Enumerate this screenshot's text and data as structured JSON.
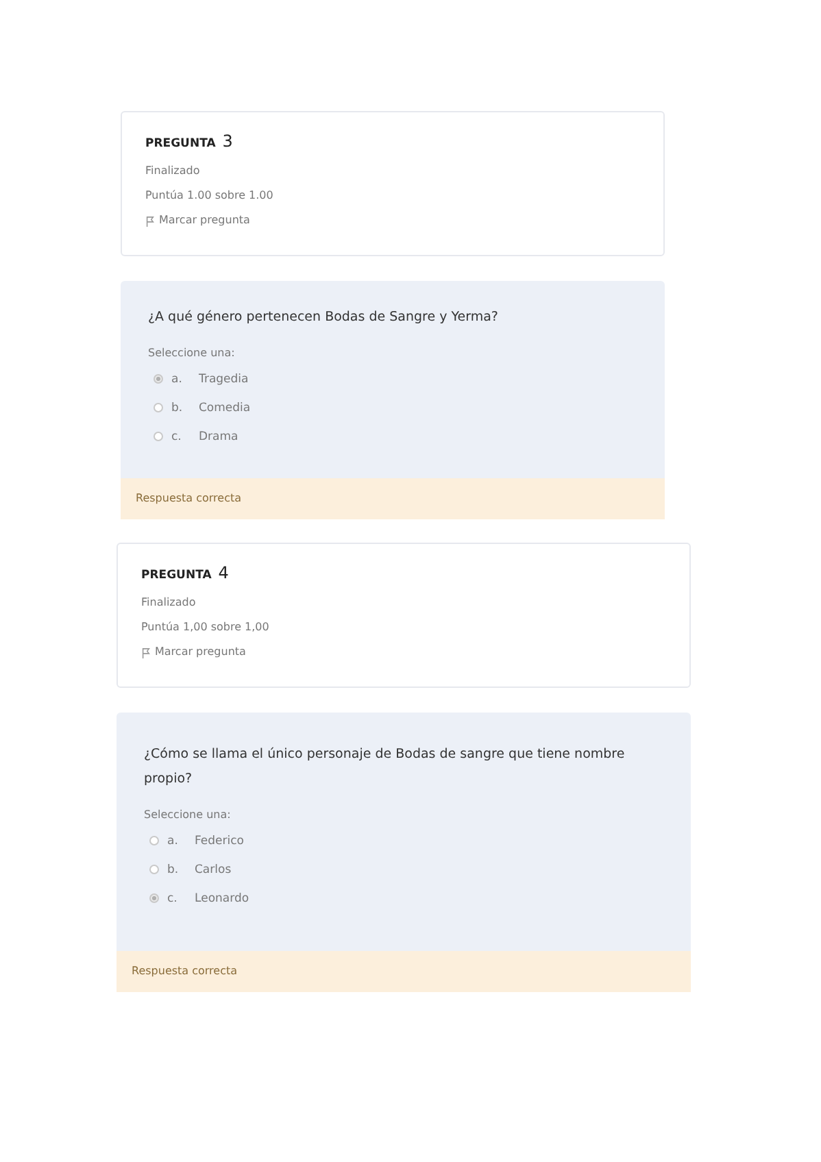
{
  "questions": [
    {
      "label": "PREGUNTA",
      "number": "3",
      "status": "Finalizado",
      "score": "Puntúa 1.00 sobre 1.00",
      "flag": "Marcar pregunta",
      "text": "¿A qué género pertenecen Bodas de Sangre y Yerma?",
      "prompt": "Seleccione una:",
      "options": [
        {
          "letter": "a.",
          "text": "Tragedia",
          "selected": true
        },
        {
          "letter": "b.",
          "text": "Comedia",
          "selected": false
        },
        {
          "letter": "c.",
          "text": "Drama",
          "selected": false
        }
      ],
      "feedback": "Respuesta correcta"
    },
    {
      "label": "PREGUNTA",
      "number": "4",
      "status": "Finalizado",
      "score": "Puntúa 1,00 sobre 1,00",
      "flag": "Marcar pregunta",
      "text": "¿Cómo se llama el único personaje de Bodas de sangre que tiene nombre propio?",
      "prompt": "Seleccione una:",
      "options": [
        {
          "letter": "a.",
          "text": "Federico",
          "selected": false
        },
        {
          "letter": "b.",
          "text": "Carlos",
          "selected": false
        },
        {
          "letter": "c.",
          "text": "Leonardo",
          "selected": true
        }
      ],
      "feedback": "Respuesta correcta"
    }
  ]
}
